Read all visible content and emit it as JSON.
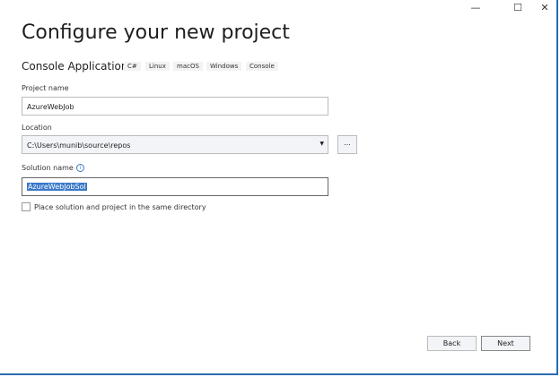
{
  "window": {
    "minimize": "—",
    "maximize": "☐",
    "close": "✕"
  },
  "title": "Configure your new project",
  "template": {
    "name": "Console Application",
    "tags": [
      "C#",
      "Linux",
      "macOS",
      "Windows",
      "Console"
    ]
  },
  "project_name": {
    "label": "Project name",
    "value": "AzureWebJob"
  },
  "location": {
    "label": "Location",
    "value": "C:\\Users\\munib\\source\\repos",
    "browse": "..."
  },
  "solution_name": {
    "label": "Solution name",
    "value": "AzureWebJobSol",
    "info": "i"
  },
  "same_dir": {
    "label": "Place solution and project in the same directory",
    "checked": false
  },
  "buttons": {
    "back": "Back",
    "next": "Next"
  }
}
